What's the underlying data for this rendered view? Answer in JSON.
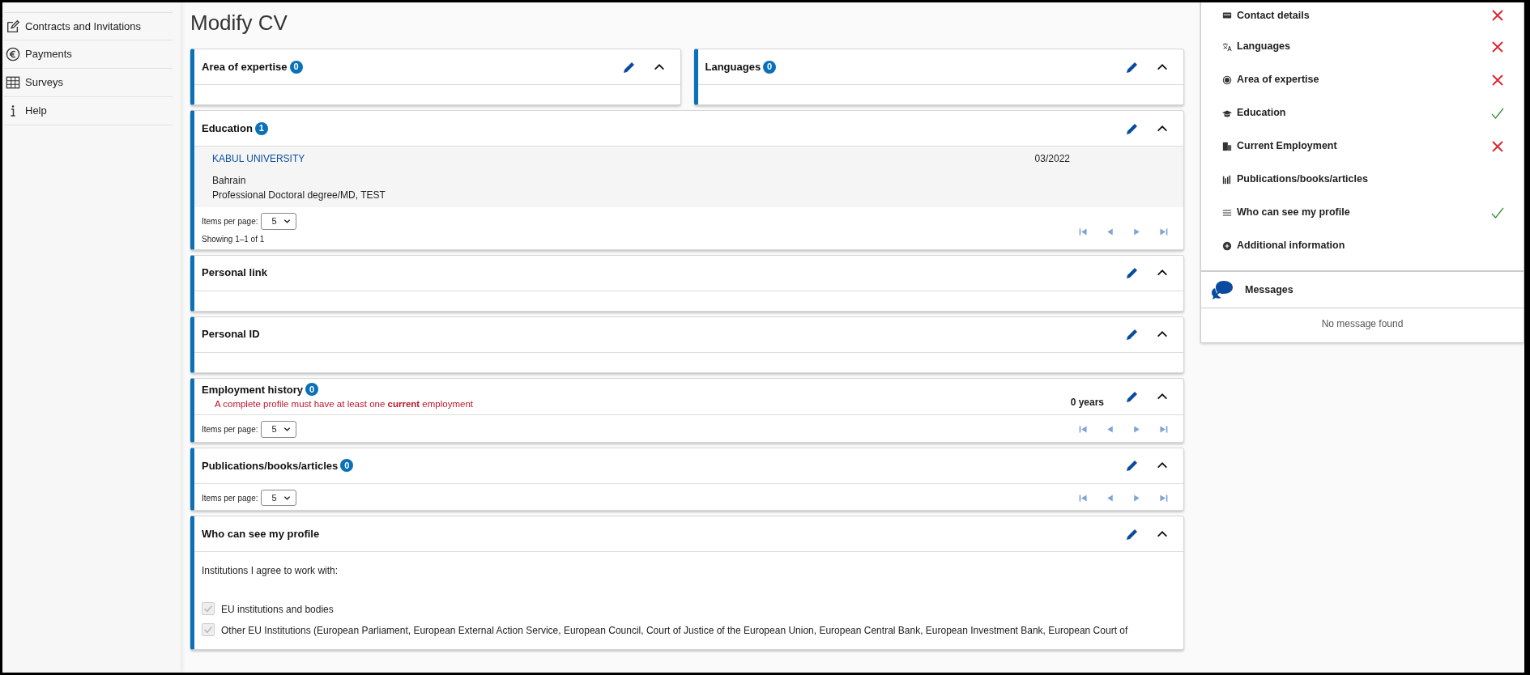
{
  "sidebar": {
    "items": [
      {
        "label": "Contracts and Invitations"
      },
      {
        "label": "Payments"
      },
      {
        "label": "Surveys"
      },
      {
        "label": "Help"
      }
    ]
  },
  "page": {
    "title": "Modify CV"
  },
  "top_sections": [
    {
      "kind": "empty",
      "title": "Area of expertise",
      "count": "0"
    },
    {
      "kind": "empty",
      "title": "Languages",
      "count": "0"
    }
  ],
  "sections": [
    {
      "kind": "list",
      "title": "Education",
      "count": "1",
      "entries": [
        {
          "institution": "KABUL UNIVERSITY",
          "date": "03/2022",
          "country": "Bahrain",
          "degree": "Professional Doctoral degree/MD, TEST"
        }
      ],
      "items_per_page_label": "Items per page:",
      "items_per_page": "5",
      "showing": "Showing 1–1 of 1"
    },
    {
      "kind": "empty",
      "title": "Personal link"
    },
    {
      "kind": "empty",
      "title": "Personal ID"
    },
    {
      "kind": "list",
      "title": "Employment history",
      "count": "0",
      "warning": "A complete profile must have at least one **current** employment",
      "total": "0 years",
      "items_per_page_label": "Items per page:",
      "items_per_page": "5"
    },
    {
      "kind": "list",
      "title": "Publications/books/articles",
      "count": "0",
      "items_per_page_label": "Items per page:",
      "items_per_page": "5"
    },
    {
      "kind": "visibility",
      "title": "Who can see my profile",
      "intro": "Institutions I agree to work with:",
      "options": [
        {
          "label": "EU institutions and bodies",
          "checked": true,
          "disabled": true
        },
        {
          "label": "Other EU Institutions (European Parliament, European External Action Service, European Council, Court of Justice of the European Union, European Central Bank, European Investment Bank, European Court of",
          "checked": true,
          "disabled": true
        }
      ]
    }
  ],
  "checklist": {
    "items": [
      {
        "label": "Contact details",
        "complete": false
      },
      {
        "label": "Languages",
        "complete": false
      },
      {
        "label": "Area of expertise",
        "complete": false
      },
      {
        "label": "Education",
        "complete": true
      },
      {
        "label": "Current Employment",
        "complete": false
      },
      {
        "label": "Publications/books/articles"
      },
      {
        "label": "Who can see my profile",
        "complete": true
      },
      {
        "label": "Additional information"
      }
    ]
  },
  "messages": {
    "title": "Messages",
    "empty_text": "No message found"
  }
}
